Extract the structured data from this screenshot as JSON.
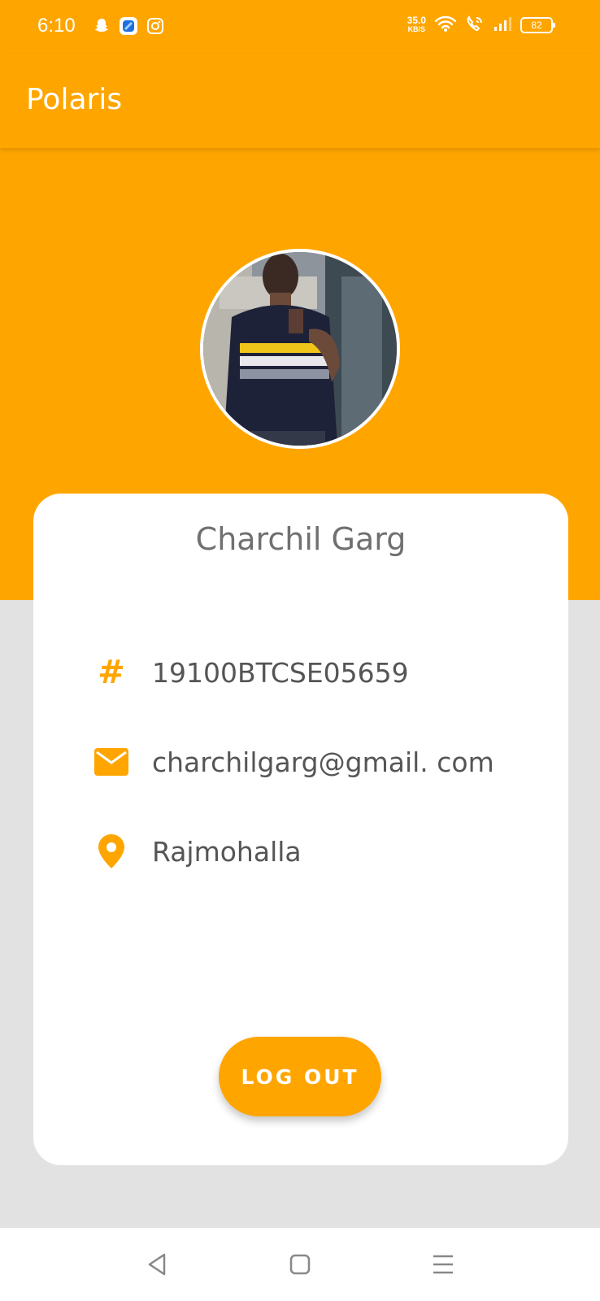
{
  "status_bar": {
    "time": "6:10",
    "net_speed_value": "35.0",
    "net_speed_unit": "KB/S",
    "battery": "82",
    "app_icons": [
      "snapchat-icon",
      "files-icon",
      "instagram-icon"
    ],
    "system_icons": [
      "wifi-icon",
      "wifi-call-icon",
      "signal-icon",
      "battery-icon"
    ]
  },
  "app_bar": {
    "title": "Polaris"
  },
  "profile": {
    "name": "Charchil Garg",
    "avatar_icon": "profile-photo",
    "fields": [
      {
        "icon": "hash-icon",
        "value": "19100BTCSE05659"
      },
      {
        "icon": "email-icon",
        "value": "charchilgarg@gmail. com"
      },
      {
        "icon": "location-pin-icon",
        "value": "Rajmohalla"
      }
    ],
    "logout_label": "LOG OUT"
  },
  "nav": {
    "icons": [
      "back-icon",
      "home-icon",
      "menu-icon"
    ]
  },
  "colors": {
    "accent": "#ffa500",
    "background": "#e2e2e2",
    "card": "#ffffff",
    "text": "#555555"
  }
}
